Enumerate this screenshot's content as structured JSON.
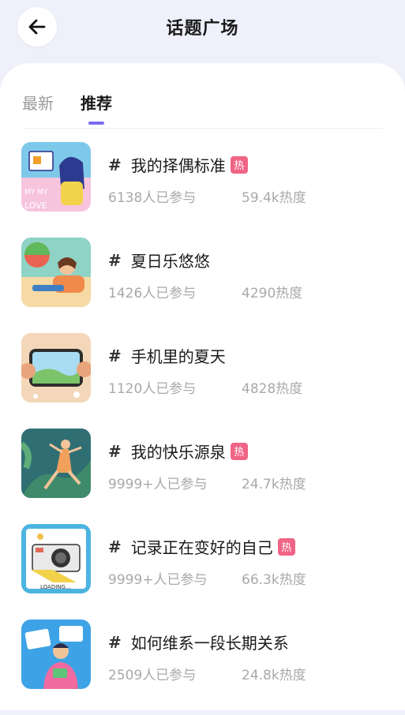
{
  "header": {
    "title": "话题广场"
  },
  "tabs": [
    {
      "label": "最新",
      "active": false
    },
    {
      "label": "推荐",
      "active": true
    }
  ],
  "colors": {
    "accent": "#7b6cf0",
    "hot": "#f06486"
  },
  "topics": [
    {
      "title": "我的择偶标准",
      "hot": true,
      "hot_label": "热",
      "participants": "6138人已参与",
      "heat": "59.4k热度"
    },
    {
      "title": "夏日乐悠悠",
      "hot": false,
      "participants": "1426人已参与",
      "heat": "4290热度"
    },
    {
      "title": "手机里的夏天",
      "hot": false,
      "participants": "1120人已参与",
      "heat": "4828热度"
    },
    {
      "title": "我的快乐源泉",
      "hot": true,
      "hot_label": "热",
      "participants": "9999+人已参与",
      "heat": "24.7k热度"
    },
    {
      "title": "记录正在变好的自己",
      "hot": true,
      "hot_label": "热",
      "participants": "9999+人已参与",
      "heat": "66.3k热度"
    },
    {
      "title": "如何维系一段长期关系",
      "hot": false,
      "participants": "2509人已参与",
      "heat": "24.8k热度"
    }
  ]
}
